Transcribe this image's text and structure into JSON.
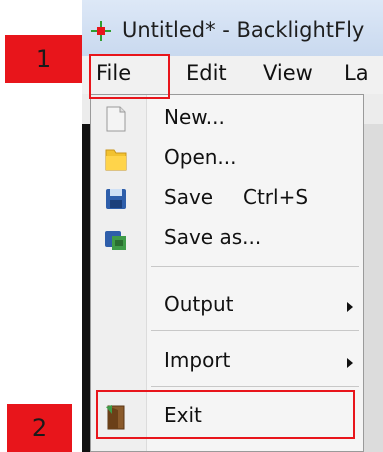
{
  "window": {
    "title": "Untitled* - BacklightFly"
  },
  "menubar": {
    "items": [
      "File",
      "Edit",
      "View",
      "La"
    ]
  },
  "file_menu": {
    "new_label": "New...",
    "open_label": "Open...",
    "save_label": "Save",
    "save_shortcut": "Ctrl+S",
    "save_as_label": "Save as...",
    "output_label": "Output",
    "import_label": "Import",
    "exit_label": "Exit"
  },
  "annotations": {
    "step1": "1",
    "step2": "2"
  },
  "colors": {
    "callout": "#e8151b",
    "title_bar": "#d4e2f4"
  }
}
